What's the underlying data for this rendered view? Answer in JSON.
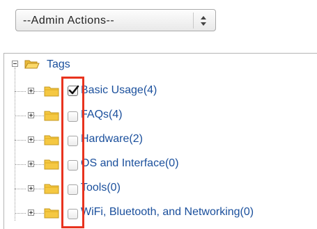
{
  "admin_select": {
    "selected": "--Admin Actions--"
  },
  "tree": {
    "root_label": "Tags",
    "items": [
      {
        "label": "Basic Usage(4)",
        "checked": true
      },
      {
        "label": "FAQs(4)",
        "checked": false
      },
      {
        "label": "Hardware(2)",
        "checked": false
      },
      {
        "label": "OS and Interface(0)",
        "checked": false
      },
      {
        "label": "Tools(0)",
        "checked": false
      },
      {
        "label": "WiFi, Bluetooth, and Networking(0)",
        "checked": false
      }
    ]
  },
  "colors": {
    "link": "#1a4f9c",
    "highlight": "#e8331e",
    "folder": "#f2c94c"
  },
  "icons": {
    "expander_root": "minus-box-icon",
    "expander_child": "plus-box-icon",
    "folder_root": "open-folder-icon",
    "folder_child": "folder-icon",
    "checkmark": "checkmark-icon",
    "select_arrows": "up-down-arrows-icon"
  }
}
